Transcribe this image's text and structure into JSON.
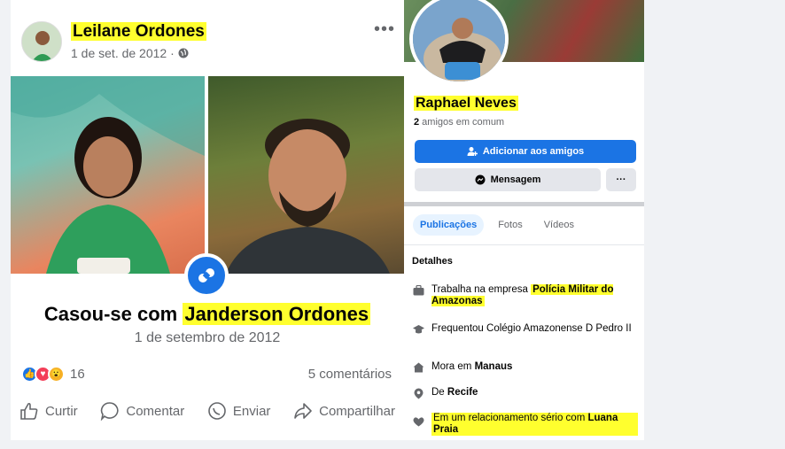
{
  "post": {
    "author": "Leilane Ordones",
    "date": "1 de set. de 2012",
    "more": "•••",
    "event_prefix": "Casou-se com ",
    "event_partner": "Janderson Ordones",
    "event_date": "1 de setembro de 2012",
    "reaction_count": "16",
    "comments": "5 comentários",
    "actions": {
      "like": "Curtir",
      "comment": "Comentar",
      "send": "Enviar",
      "share": "Compartilhar"
    }
  },
  "profile": {
    "name": "Raphael Neves",
    "mutual_count": "2",
    "mutual_label": " amigos em comum",
    "add_friend": "Adicionar aos amigos",
    "message": "Mensagem",
    "more": "···",
    "tabs": [
      "Publicações",
      "Fotos",
      "Vídeos"
    ],
    "details_title": "Detalhes",
    "details": {
      "work_prefix": "Trabalha na empresa ",
      "work_place": "Polícia Militar do Amazonas",
      "study": "Frequentou Colégio Amazonense D Pedro II",
      "lives_prefix": "Mora em ",
      "lives_city": "Manaus",
      "from_prefix": "De ",
      "from_city": "Recife",
      "rel_prefix": "Em um relacionamento sério com ",
      "rel_partner": "Luana Praia"
    }
  },
  "colors": {
    "primary": "#1b74e4",
    "highlight": "#ffff2e",
    "muted": "#65676b"
  }
}
